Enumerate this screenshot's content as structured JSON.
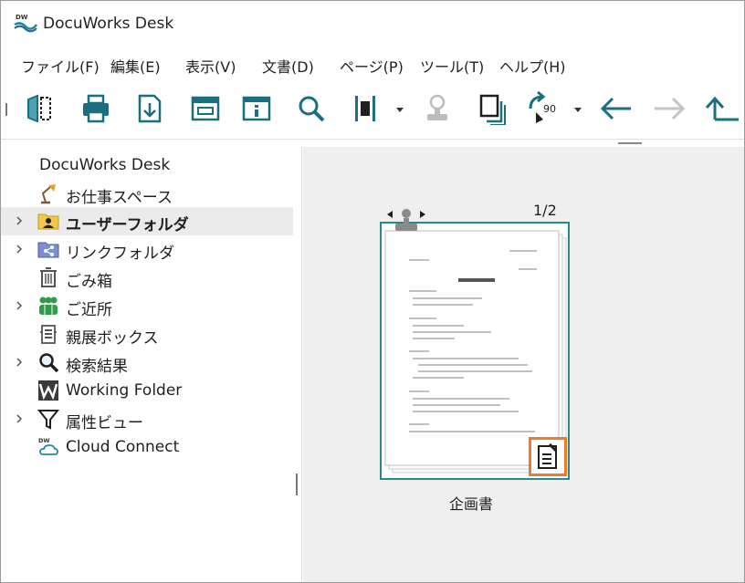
{
  "app": {
    "title": "DocuWorks Desk",
    "logo_text": "DW"
  },
  "menu": [
    {
      "label": "ファイル(F)"
    },
    {
      "label": "編集(E)"
    },
    {
      "label": "表示(V)"
    },
    {
      "label": "文書(D)"
    },
    {
      "label": "ページ(P)"
    },
    {
      "label": "ツール(T)"
    },
    {
      "label": "ヘルプ(H)"
    }
  ],
  "toolbar": {
    "icons": [
      "split-icon",
      "print-icon",
      "import-icon",
      "window-icon",
      "info-icon",
      "search-icon",
      "bind-icon",
      "stamp-icon",
      "copy-icon",
      "rotate-90-icon",
      "back-arrow-icon",
      "forward-arrow-icon",
      "up-arrow-icon"
    ],
    "rotate_label": "90"
  },
  "sidebar": {
    "root": "DocuWorks Desk",
    "items": [
      {
        "label": "お仕事スペース",
        "icon": "desk-lamp-icon",
        "expandable": false
      },
      {
        "label": "ユーザーフォルダ",
        "icon": "user-folder-icon",
        "expandable": true,
        "selected": true
      },
      {
        "label": "リンクフォルダ",
        "icon": "link-folder-icon",
        "expandable": true
      },
      {
        "label": "ごみ箱",
        "icon": "trash-icon",
        "expandable": false
      },
      {
        "label": "ご近所",
        "icon": "neighborhood-icon",
        "expandable": true
      },
      {
        "label": "親展ボックス",
        "icon": "confidential-box-icon",
        "expandable": false
      },
      {
        "label": "検索結果",
        "icon": "search-results-icon",
        "expandable": true
      },
      {
        "label": "Working Folder",
        "icon": "working-folder-icon",
        "expandable": false
      },
      {
        "label": "属性ビュー",
        "icon": "filter-icon",
        "expandable": true
      },
      {
        "label": "Cloud Connect",
        "icon": "cloud-connect-icon",
        "expandable": false
      }
    ]
  },
  "document": {
    "title": "企画書",
    "page_count": "1/2",
    "preview": {
      "heading": "展示会 企画書",
      "lines": [
        "令和〇年〇月〇日",
        "関係各位殿",
        "富士 太郎"
      ]
    }
  },
  "colors": {
    "accent": "#2a8a8a",
    "highlight": "#f07a2a",
    "selected_row": "#ebebeb"
  }
}
